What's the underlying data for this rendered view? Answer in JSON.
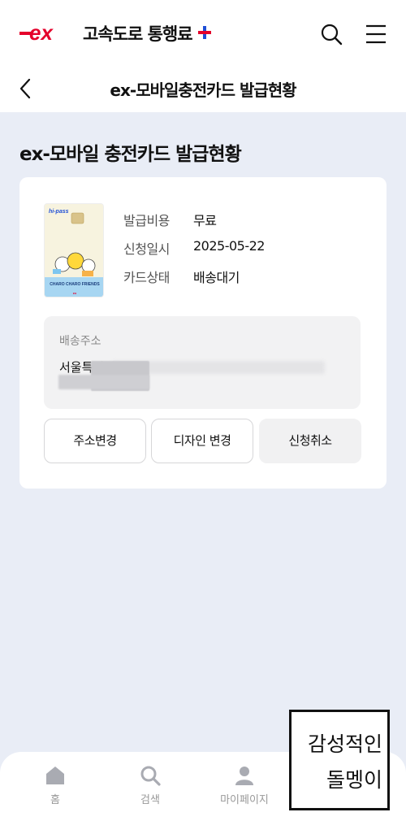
{
  "header": {
    "logo_mark": "ex",
    "logo_text": "고속도로 통행료",
    "brand_red": "#e4002b",
    "brand_blue": "#1f4fd6",
    "search_icon": "search-icon",
    "menu_icon": "hamburger-menu-icon"
  },
  "subheader": {
    "back_icon": "chevron-left-icon",
    "title": "ex-모바일충전카드 발급현황"
  },
  "main": {
    "heading": "ex-모바일 충전카드 발급현황",
    "card": {
      "image_label": "CHARO CHARO FRIENDS",
      "info": [
        {
          "label": "발급비용",
          "value": "무료"
        },
        {
          "label": "신청일시",
          "value": "2025-05-22"
        },
        {
          "label": "카드상태",
          "value": "배송대기"
        }
      ],
      "address": {
        "label": "배송주소",
        "value": "서울특별시"
      },
      "buttons": {
        "change_address": "주소변경",
        "change_design": "디자인 변경",
        "cancel": "신청취소"
      }
    }
  },
  "bottom_nav": {
    "items": [
      {
        "label": "홈",
        "icon": "home-icon"
      },
      {
        "label": "검색",
        "icon": "search-icon"
      },
      {
        "label": "마이페이지",
        "icon": "person-icon"
      }
    ]
  },
  "stamp": {
    "line1": "감성적인",
    "line2": "돌멩이"
  }
}
